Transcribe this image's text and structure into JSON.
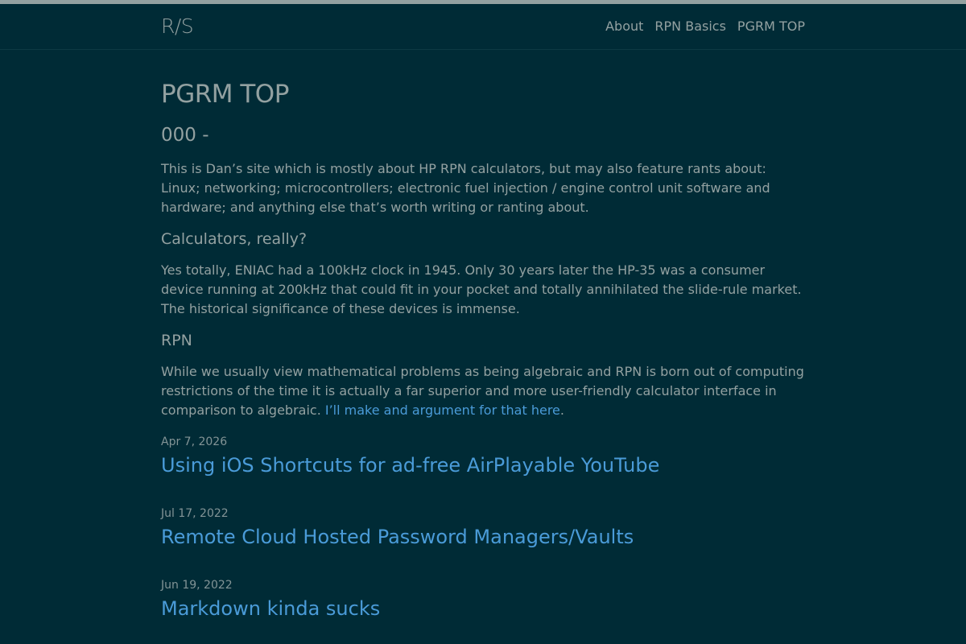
{
  "header": {
    "site_title": "R/S",
    "nav": [
      {
        "label": "About"
      },
      {
        "label": "RPN Basics"
      },
      {
        "label": "PGRM TOP"
      }
    ]
  },
  "main": {
    "page_title": "PGRM TOP",
    "section_heading": "000 -",
    "intro_paragraph": "This is Dan’s site which is mostly about HP RPN calculators, but may also feature rants about: Linux; networking; microcontrollers; electronic fuel injection / engine control unit software and hardware; and anything else that’s worth writing or ranting about.",
    "calculators_heading": "Calculators, really?",
    "calculators_paragraph": "Yes totally, ENIAC had a 100kHz clock in 1945. Only 30 years later the HP-35 was a consumer device running at 200kHz that could fit in your pocket and totally annihilated the slide-rule market. The historical significance of these devices is immense.",
    "rpn_heading": "RPN",
    "rpn_paragraph": "While we usually view mathematical problems as being algebraic and RPN is born out of computing restrictions of the time it is actually a far superior and more user-friendly calculator interface in comparison to algebraic. ",
    "rpn_link_text": "I’ll make and argument for that here",
    "rpn_paragraph_end": "."
  },
  "posts": [
    {
      "date": "Apr 7, 2026",
      "title": "Using iOS Shortcuts for ad-free AirPlayable YouTube"
    },
    {
      "date": "Jul 17, 2022",
      "title": "Remote Cloud Hosted Password Managers/Vaults"
    },
    {
      "date": "Jun 19, 2022",
      "title": "Markdown kinda sucks"
    }
  ],
  "colors": {
    "background": "#002b36",
    "text": "#93a1a1",
    "link": "#4a9bd8"
  }
}
